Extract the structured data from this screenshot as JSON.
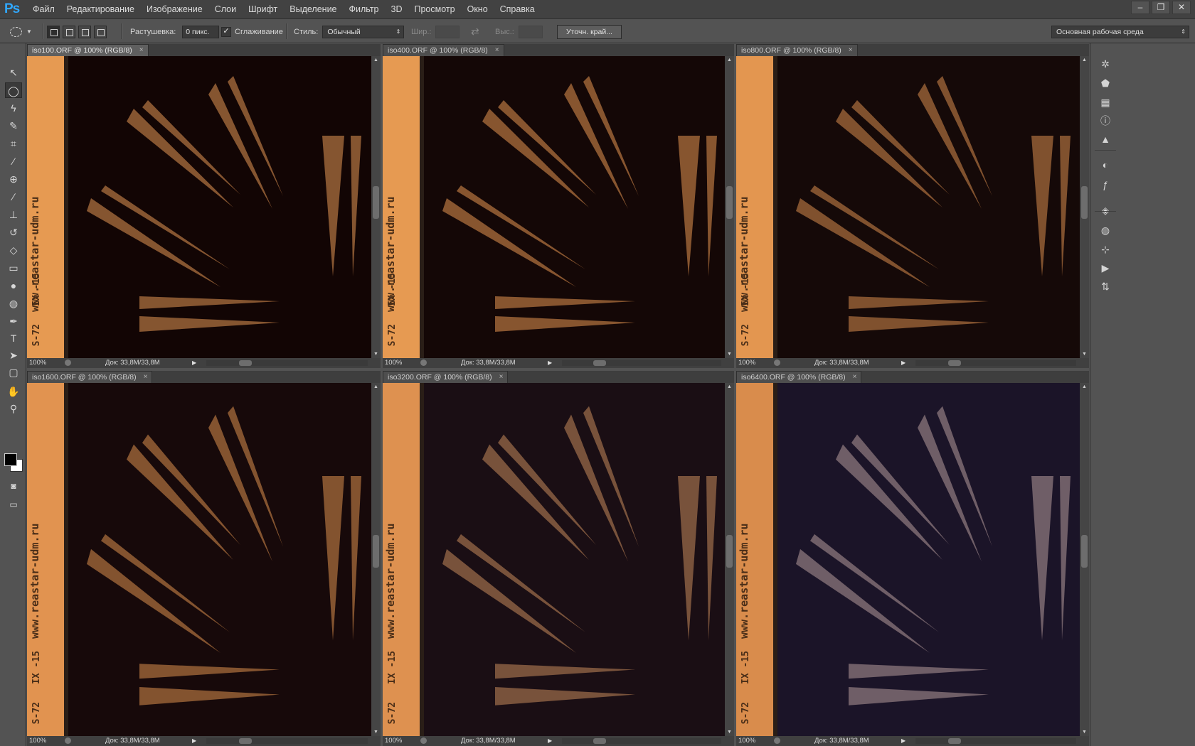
{
  "app": {
    "logo": "Ps",
    "menu": [
      "Файл",
      "Редактирование",
      "Изображение",
      "Слои",
      "Шрифт",
      "Выделение",
      "Фильтр",
      "3D",
      "Просмотр",
      "Окно",
      "Справка"
    ],
    "window_controls": [
      "–",
      "❐",
      "✕"
    ]
  },
  "options": {
    "feather_label": "Растушевка:",
    "feather_value": "0 пикс.",
    "antialias_label": "Сглаживание",
    "antialias_checked": "✓",
    "style_label": "Стиль:",
    "style_value": "Обычный",
    "width_label": "Шир.:",
    "height_label": "Выс.:",
    "refine_button": "Уточн. край...",
    "workspace_value": "Основная рабочая среда"
  },
  "documents": [
    {
      "title": "iso100.ORF @ 100% (RGB/8)",
      "close": "×",
      "zoom": "100%",
      "doc_size": "Док: 33,8M/33,8M",
      "tint": "#120504",
      "strip_color": "#e69a52",
      "wedge_color": "#8c5a33",
      "wedge_opacity": 0.95
    },
    {
      "title": "iso400.ORF @ 100% (RGB/8)",
      "close": "×",
      "zoom": "100%",
      "doc_size": "Док: 33,8M/33,8M",
      "tint": "#140706",
      "strip_color": "#e69a52",
      "wedge_color": "#8d5a32",
      "wedge_opacity": 0.95
    },
    {
      "title": "iso800.ORF @ 100% (RGB/8)",
      "close": "×",
      "zoom": "100%",
      "doc_size": "Док: 33,8M/33,8M",
      "tint": "#150908",
      "strip_color": "#e39650",
      "wedge_color": "#8a5832",
      "wedge_opacity": 0.92
    },
    {
      "title": "iso1600.ORF @ 100% (RGB/8)",
      "close": "×",
      "zoom": "100%",
      "doc_size": "Док: 33,8M/33,8M",
      "tint": "#17090a",
      "strip_color": "#e19350",
      "wedge_color": "#8f5c33",
      "wedge_opacity": 0.9
    },
    {
      "title": "iso3200.ORF @ 100% (RGB/8)",
      "close": "×",
      "zoom": "100%",
      "doc_size": "Док: 33,8M/33,8M",
      "tint": "#1a0e14",
      "strip_color": "#de9150",
      "wedge_color": "#8a5e42",
      "wedge_opacity": 0.85
    },
    {
      "title": "iso6400.ORF @ 100% (RGB/8)",
      "close": "×",
      "zoom": "100%",
      "doc_size": "Док: 33,8M/33,8M",
      "tint": "#1b1428",
      "strip_color": "#d98c4c",
      "wedge_color": "#857077",
      "wedge_opacity": 0.8
    }
  ],
  "image_text": {
    "url": "www.reastar-udm.ru",
    "code1": "IX -15",
    "code2": "S-72"
  },
  "tools": [
    "move-tool",
    "elliptical-marquee-tool",
    "lasso-tool",
    "quick-selection-tool",
    "crop-tool",
    "eyedropper-tool",
    "spot-healing-tool",
    "brush-tool",
    "clone-stamp-tool",
    "history-brush-tool",
    "eraser-tool",
    "gradient-tool",
    "blur-tool",
    "dodge-tool",
    "pen-tool",
    "type-tool",
    "path-selection-tool",
    "rectangle-tool",
    "hand-tool",
    "zoom-tool"
  ],
  "tool_glyphs": [
    "↖",
    "◯",
    "ϟ",
    "✎",
    "⌗",
    "⁄",
    "⊕",
    "∕",
    "⊥",
    "↺",
    "◇",
    "▭",
    "●",
    "◍",
    "✒",
    "T",
    "➤",
    "▢",
    "✋",
    "⚲"
  ],
  "type_tool_label": "T",
  "right_icons": [
    "✲",
    "⬟",
    "▦",
    "ⓘ",
    "▲",
    "◐",
    "ƒ",
    "◈",
    "◍",
    "⊹",
    "▶",
    "⇅"
  ]
}
